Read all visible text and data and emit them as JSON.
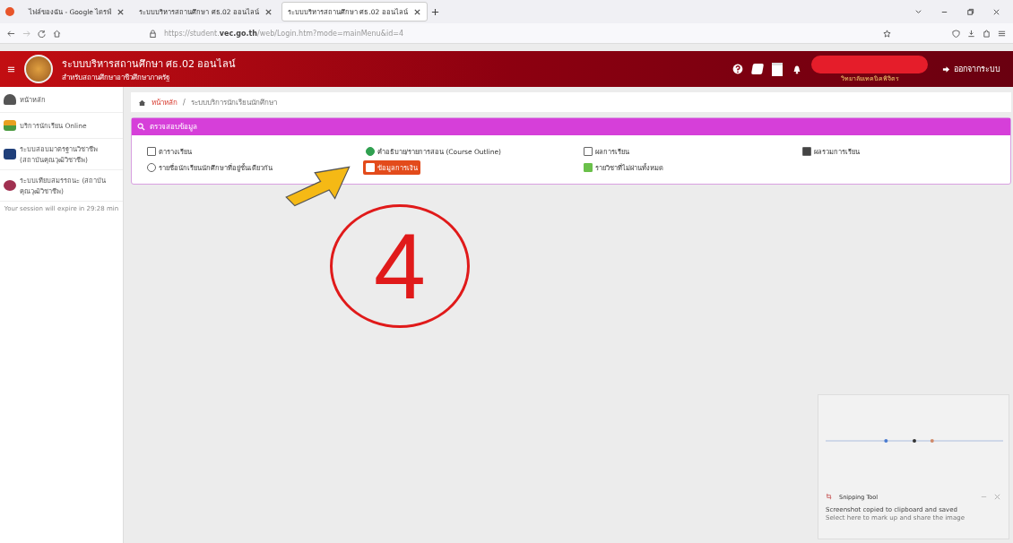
{
  "browser": {
    "tabs": [
      {
        "label": "ไฟล์ของฉัน - Google ไดรฟ์",
        "selected": false
      },
      {
        "label": "ระบบบริหารสถานศึกษา ศธ.02 ออนไลน์",
        "selected": false
      },
      {
        "label": "ระบบบริหารสถานศึกษา ศธ.02 ออนไลน์",
        "selected": true
      }
    ],
    "url_host": "https://student.",
    "url_domain": "vec.go.th",
    "url_path": "/web/Login.htm?mode=mainMenu&id=4"
  },
  "header": {
    "title": "ระบบบริหารสถานศึกษา ศธ.02 ออนไลน์",
    "subtitle": "สำหรับสถานศึกษาอาชีวศึกษาภาครัฐ",
    "college": "วิทยาลัยเทคนิคพิจิตร",
    "logout": "ออกจากระบบ"
  },
  "sidebar": {
    "items": [
      {
        "label": "หน้าหลัก"
      },
      {
        "label": "บริการนักเรียน Online"
      },
      {
        "label": "ระบบสอบมาตรฐานวิชาชีพ (สถาบันคุณวุฒิวิชาชีพ)"
      },
      {
        "label": "ระบบเทียบสมรรถนะ (สถาบันคุณวุฒิวิชาชีพ)"
      }
    ],
    "session": "Your session will expire in 29:28 min"
  },
  "breadcrumb": [
    "หน้าหลัก",
    "ระบบบริการนักเรียนนักศึกษา"
  ],
  "breadcrumb_separator": "/",
  "panel": {
    "title": "ตรวจสอบข้อมูล",
    "items": [
      {
        "label": "ตารางเรียน",
        "selected": false
      },
      {
        "label": "คำอธิบาย/รายการสอน (Course Outline)",
        "selected": false
      },
      {
        "label": "ผลการเรียน",
        "selected": false
      },
      {
        "label": "ผลรวมการเรียน",
        "selected": false
      },
      {
        "label": "รายชื่อนักเรียนนักศึกษาที่อยู่ชั้นเดียวกัน",
        "selected": false
      },
      {
        "label": "ข้อมูลการเงิน",
        "selected": true
      },
      {
        "label": "รายวิชาที่ไม่ผ่านทั้งหมด",
        "selected": false
      }
    ]
  },
  "annotation": {
    "number": "4"
  },
  "toast": {
    "app": "Snipping Tool",
    "title": "Screenshot copied to clipboard and saved",
    "body": "Select here to mark up and share the image"
  }
}
